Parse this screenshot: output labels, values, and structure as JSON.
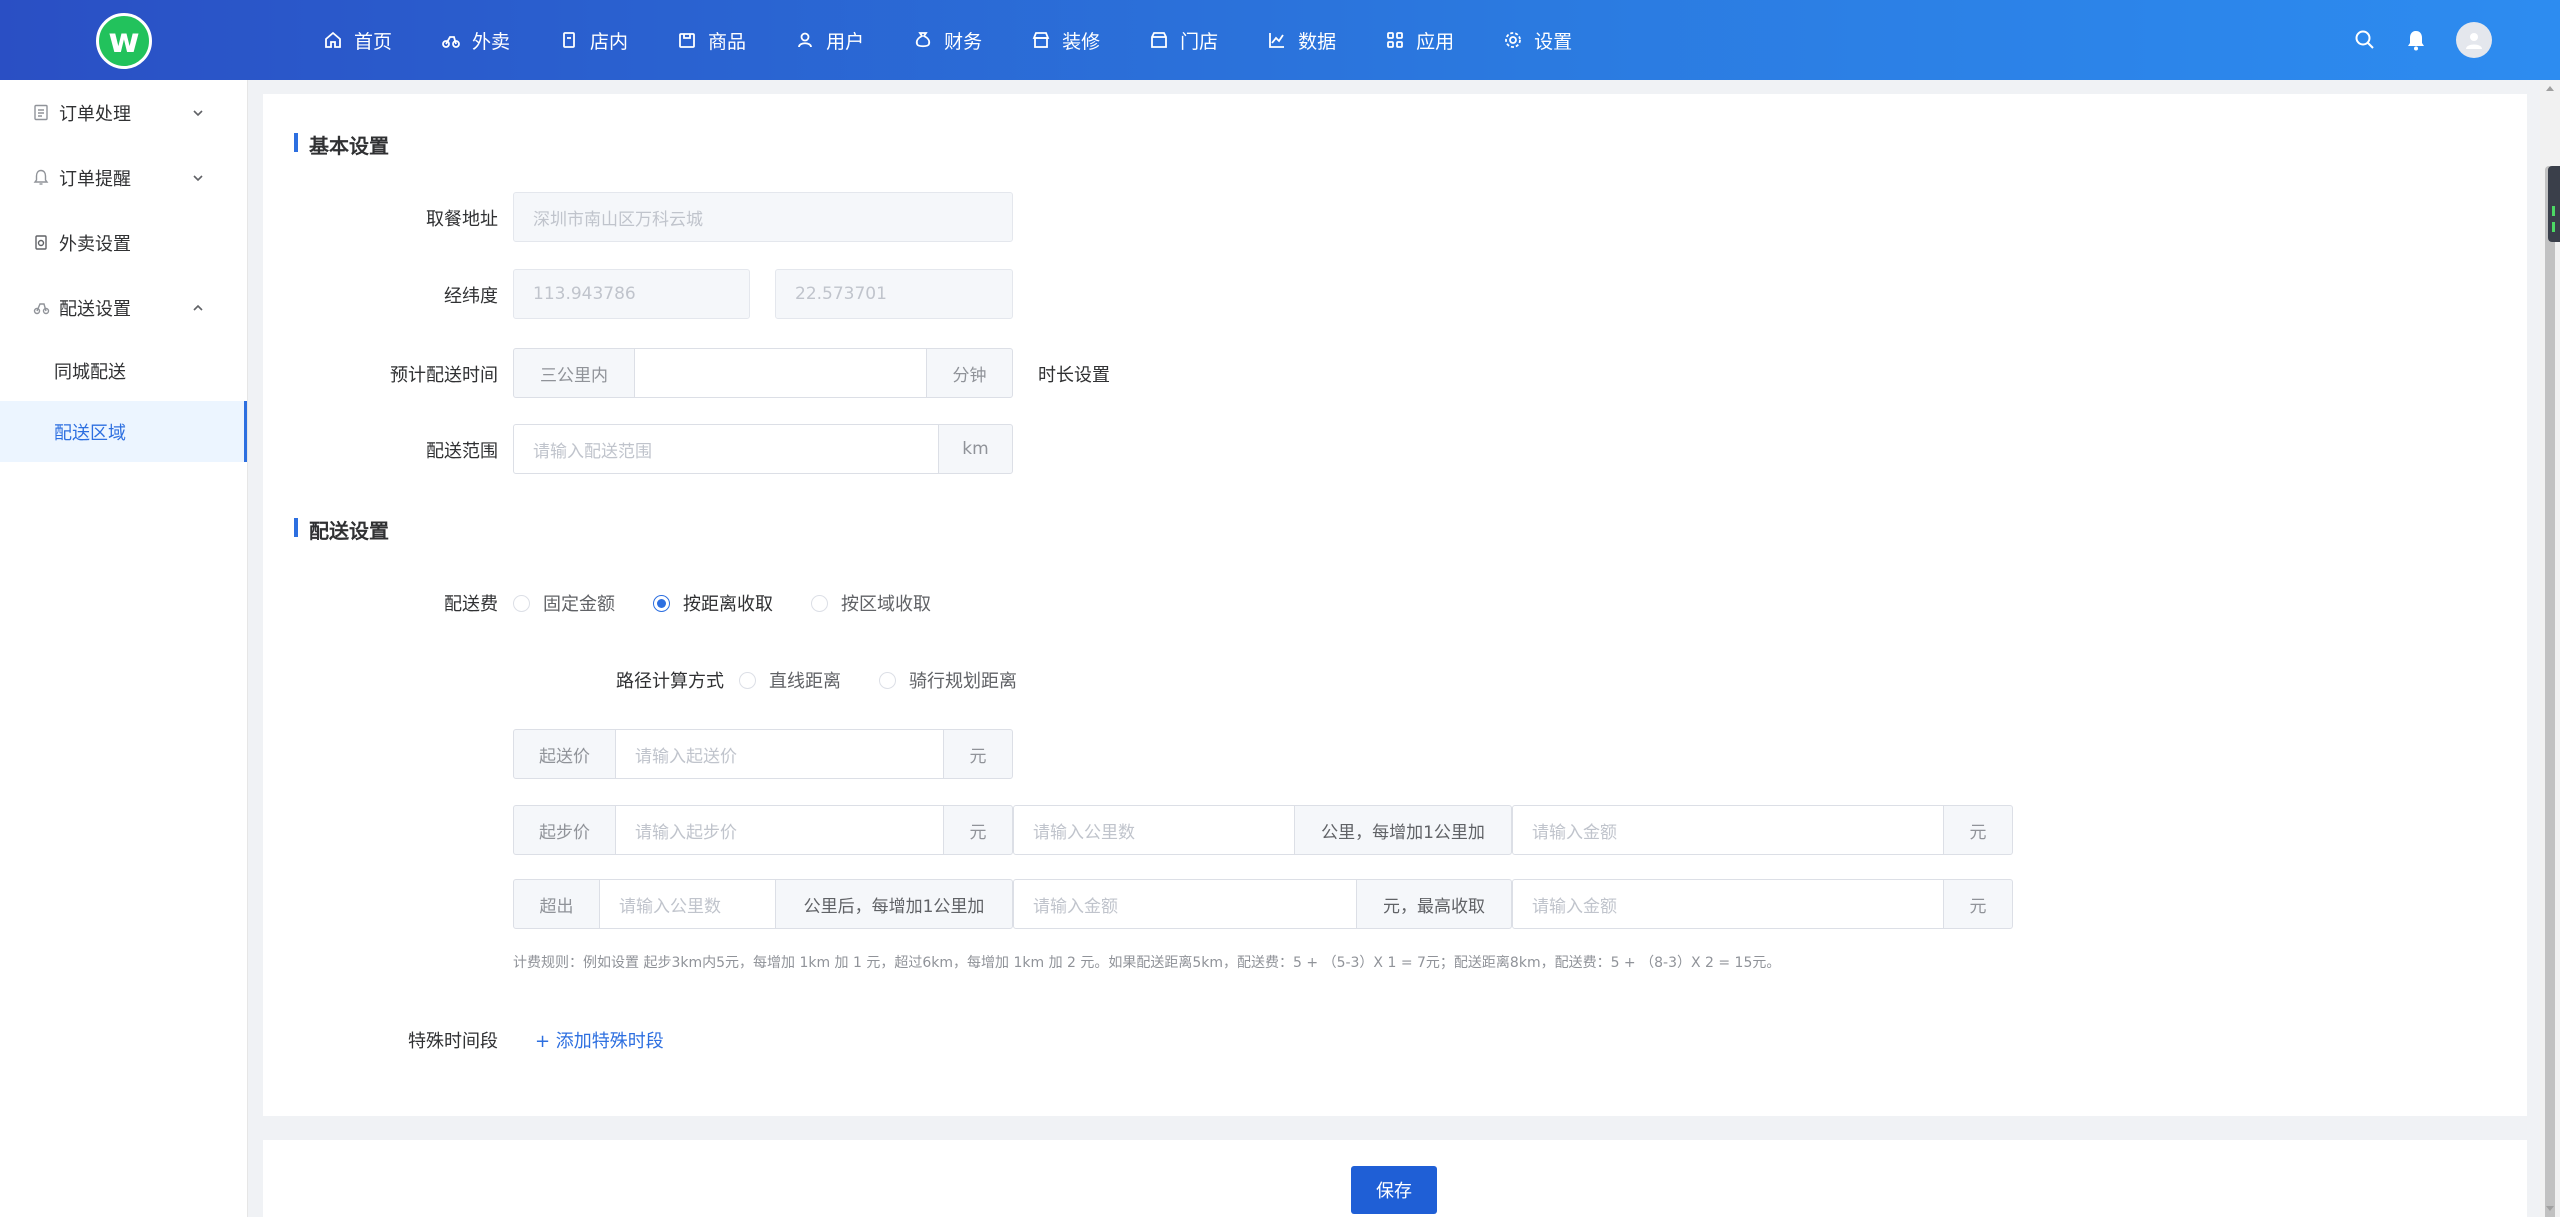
{
  "app": {
    "logo_letter": "w",
    "accent": "#2d6fe0",
    "logo_color": "#22c25c"
  },
  "nav": [
    {
      "label": "首页",
      "icon": "home-icon"
    },
    {
      "label": "外卖",
      "icon": "bike-icon"
    },
    {
      "label": "店内",
      "icon": "store-inside-icon"
    },
    {
      "label": "商品",
      "icon": "goods-icon"
    },
    {
      "label": "用户",
      "icon": "user-icon"
    },
    {
      "label": "财务",
      "icon": "money-bag-icon"
    },
    {
      "label": "装修",
      "icon": "decorate-icon"
    },
    {
      "label": "门店",
      "icon": "shop-icon"
    },
    {
      "label": "数据",
      "icon": "chart-icon"
    },
    {
      "label": "应用",
      "icon": "apps-icon"
    },
    {
      "label": "设置",
      "icon": "gear-icon"
    }
  ],
  "sidebar": {
    "items": [
      {
        "label": "订单处理"
      },
      {
        "label": "订单提醒"
      },
      {
        "label": "外卖设置"
      },
      {
        "label": "配送设置"
      }
    ],
    "sub": [
      {
        "label": "同城配送"
      },
      {
        "label": "配送区域"
      }
    ]
  },
  "basic": {
    "title": "基本设置",
    "pickup_label": "取餐地址",
    "pickup_value": "深圳市南山区万科云城",
    "latlng_label": "经纬度",
    "lng_value": "113.943786",
    "lat_value": "22.573701",
    "eta_label": "预计配送时间",
    "eta_prefix": "三公里内",
    "eta_suffix": "分钟",
    "eta_link": "时长设置",
    "range_label": "配送范围",
    "range_placeholder": "请输入配送范围",
    "range_unit": "km"
  },
  "delivery": {
    "title": "配送设置",
    "fee_label": "配送费",
    "fee_options": [
      "固定金额",
      "按距离收取",
      "按区域收取"
    ],
    "fee_selected": "按距离收取",
    "route_label": "路径计算方式",
    "route_options": [
      "直线距离",
      "骑行规划距离"
    ],
    "min_order_prefix": "起送价",
    "min_order_placeholder": "请输入起送价",
    "yuan": "元",
    "start_price_prefix": "起步价",
    "start_price_placeholder": "请输入起步价",
    "km_placeholder": "请输入公里数",
    "per_km_label": "公里，每增加1公里加",
    "amount_placeholder": "请输入金额",
    "exceed_prefix": "超出",
    "after_km_label": "公里后，每增加1公里加",
    "max_label": "元，最高收取",
    "rule_hint": "计费规则：例如设置 起步3km内5元，每增加 1km 加 1 元，超过6km，每增加 1km 加 2 元。如果配送距离5km，配送费：5 + （5-3）X 1 = 7元；配送距离8km，配送费：5 + （8-3）X 2 = 15元。",
    "special_label": "特殊时间段",
    "special_link": "+ 添加特殊时段"
  },
  "save_label": "保存"
}
